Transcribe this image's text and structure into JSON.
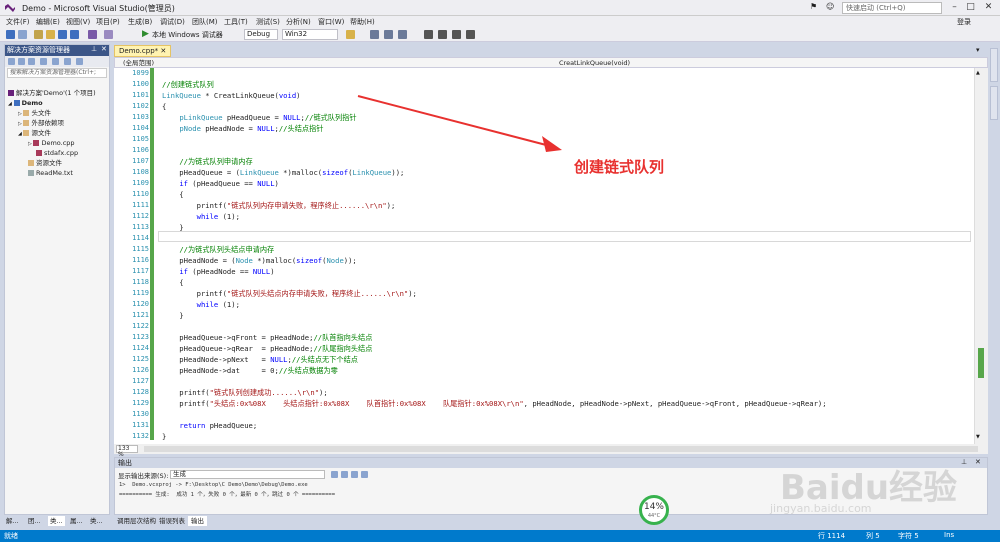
{
  "window": {
    "title": "Demo - Microsoft Visual Studio(管理员)",
    "quick_launch_placeholder": "快速启动 (Ctrl+Q)",
    "sign_in": "登录"
  },
  "menu": [
    "文件(F)",
    "编辑(E)",
    "视图(V)",
    "项目(P)",
    "生成(B)",
    "调试(D)",
    "团队(M)",
    "工具(T)",
    "测试(S)",
    "分析(N)",
    "窗口(W)",
    "帮助(H)"
  ],
  "toolbar": {
    "debugger": "本地 Windows 调试器",
    "config": "Debug",
    "platform": "Win32"
  },
  "solution_explorer": {
    "title": "解决方案资源管理器",
    "search_placeholder": "搜索解决方案资源管理器(Ctrl+;",
    "items": [
      "解决方案'Demo'(1 个项目)",
      "Demo",
      "头文件",
      "外部依赖项",
      "源文件",
      "Demo.cpp",
      "stdafx.cpp",
      "资源文件",
      "ReadMe.txt"
    ],
    "tabs": [
      "解...",
      "团...",
      "类...",
      "属...",
      "类..."
    ]
  },
  "editor": {
    "tab_label": "Demo.cpp*",
    "nav_scope": "(全局范围)",
    "nav_member": "CreatLinkQueue(void)",
    "zoom": "133 %",
    "line_numbers": [
      "1099",
      "1100",
      "1101",
      "1102",
      "1103",
      "1104",
      "1105",
      "1106",
      "1107",
      "1108",
      "1109",
      "1110",
      "1111",
      "1112",
      "1113",
      "1114",
      "1115",
      "1116",
      "1117",
      "1118",
      "1119",
      "1120",
      "1121",
      "1122",
      "1123",
      "1124",
      "1125",
      "1126",
      "1127",
      "1128",
      "1129",
      "1130",
      "1131",
      "1132"
    ]
  },
  "annotation": "创建链式队列",
  "output": {
    "title": "输出",
    "source_label": "显示输出来源(S):",
    "source_value": "生成",
    "line1": "1>  Demo.vcxproj -> F:\\Desktop\\C Demo\\Demo\\Debug\\Demo.exe",
    "line2": "========== 生成:  成功 1 个，失败 0 个，最新 0 个，跳过 0 个 ==========",
    "tabs": [
      "调用层次结构",
      "错误列表",
      "输出"
    ]
  },
  "status": {
    "ready": "就绪",
    "row": "行 1114",
    "col": "列 5",
    "char": "字符 5",
    "mode": "Ins"
  },
  "widget": {
    "cpu": "14%",
    "temp": "44°C"
  },
  "watermark": {
    "text": "Baidu经验",
    "sub": "jingyan.baidu.com"
  },
  "colors": {
    "statusbar": "#007acc",
    "header": "#3c5688",
    "annotation": "#e8312f"
  }
}
